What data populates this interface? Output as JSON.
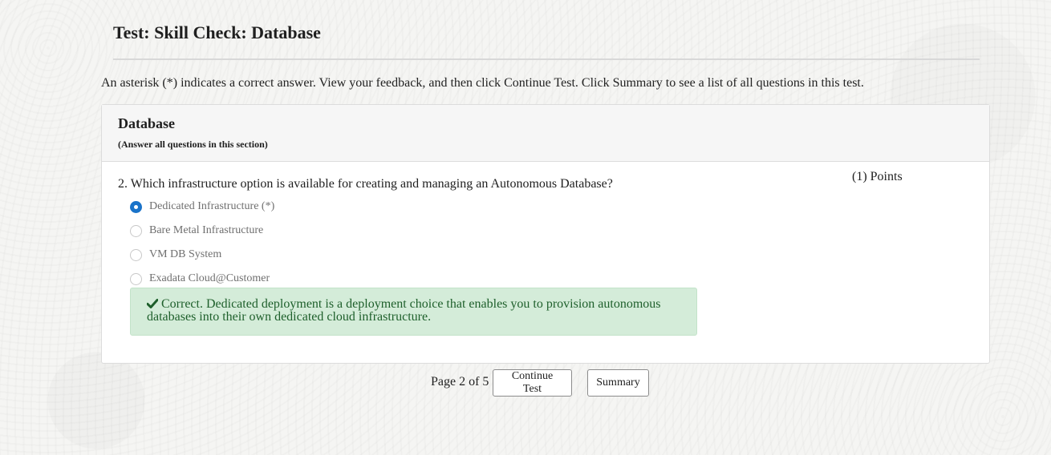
{
  "page": {
    "title": "Test: Skill Check: Database",
    "instructions": "An asterisk (*) indicates a correct answer. View your feedback, and then click Continue Test. Click Summary to see a list of all questions in this test."
  },
  "section": {
    "title": "Database",
    "subtitle": "(Answer all questions in this section)"
  },
  "question": {
    "text": "2. Which infrastructure option is available for creating and managing an Autonomous Database?",
    "points": "(1) Points",
    "options": [
      {
        "label": "Dedicated Infrastructure (*)",
        "selected": true
      },
      {
        "label": "Bare Metal Infrastructure",
        "selected": false
      },
      {
        "label": "VM DB System",
        "selected": false
      },
      {
        "label": "Exadata Cloud@Customer",
        "selected": false
      }
    ],
    "feedback": {
      "icon": "checkmark-icon",
      "text": "Correct. Dedicated deployment is a deployment choice that enables you to provision autonomous databases into their own dedicated cloud infrastructure."
    }
  },
  "footer": {
    "page_indicator": "Page 2 of 5",
    "continue_label": "Continue Test",
    "summary_label": "Summary"
  },
  "colors": {
    "accent": "#1a73c9",
    "feedback_bg": "#d4ecd9",
    "feedback_text": "#1e5f2b"
  }
}
